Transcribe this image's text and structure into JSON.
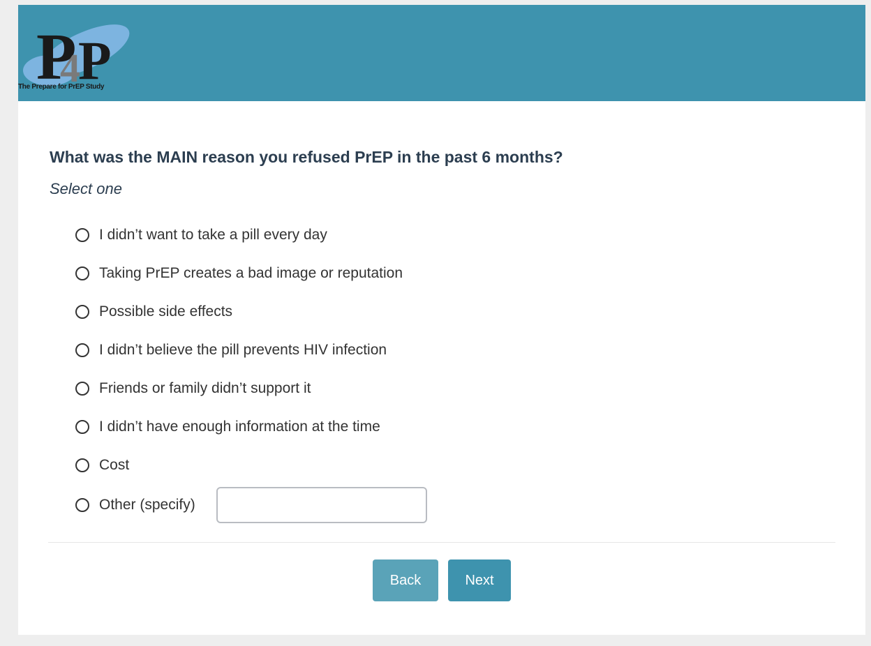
{
  "header": {
    "logo_text": "P4P",
    "logo_caption": "The Prepare for PrEP Study"
  },
  "question": {
    "text": "What was the MAIN reason you refused PrEP in the past 6 months?",
    "instruction": "Select one",
    "options": [
      {
        "label": "I didn’t want to take a pill every day"
      },
      {
        "label": "Taking PrEP creates a bad image or reputation"
      },
      {
        "label": "Possible side effects"
      },
      {
        "label": "I didn’t believe the pill prevents HIV infection"
      },
      {
        "label": "Friends or family didn’t support it"
      },
      {
        "label": "I didn’t have enough information at the time"
      },
      {
        "label": "Cost"
      },
      {
        "label": "Other (specify)"
      }
    ],
    "other_input_value": ""
  },
  "nav": {
    "back_label": "Back",
    "next_label": "Next"
  },
  "colors": {
    "header_bg": "#3e93ae",
    "back_button": "#5aa3b8",
    "next_button": "#3e93ae",
    "question_text": "#2c3e50"
  }
}
